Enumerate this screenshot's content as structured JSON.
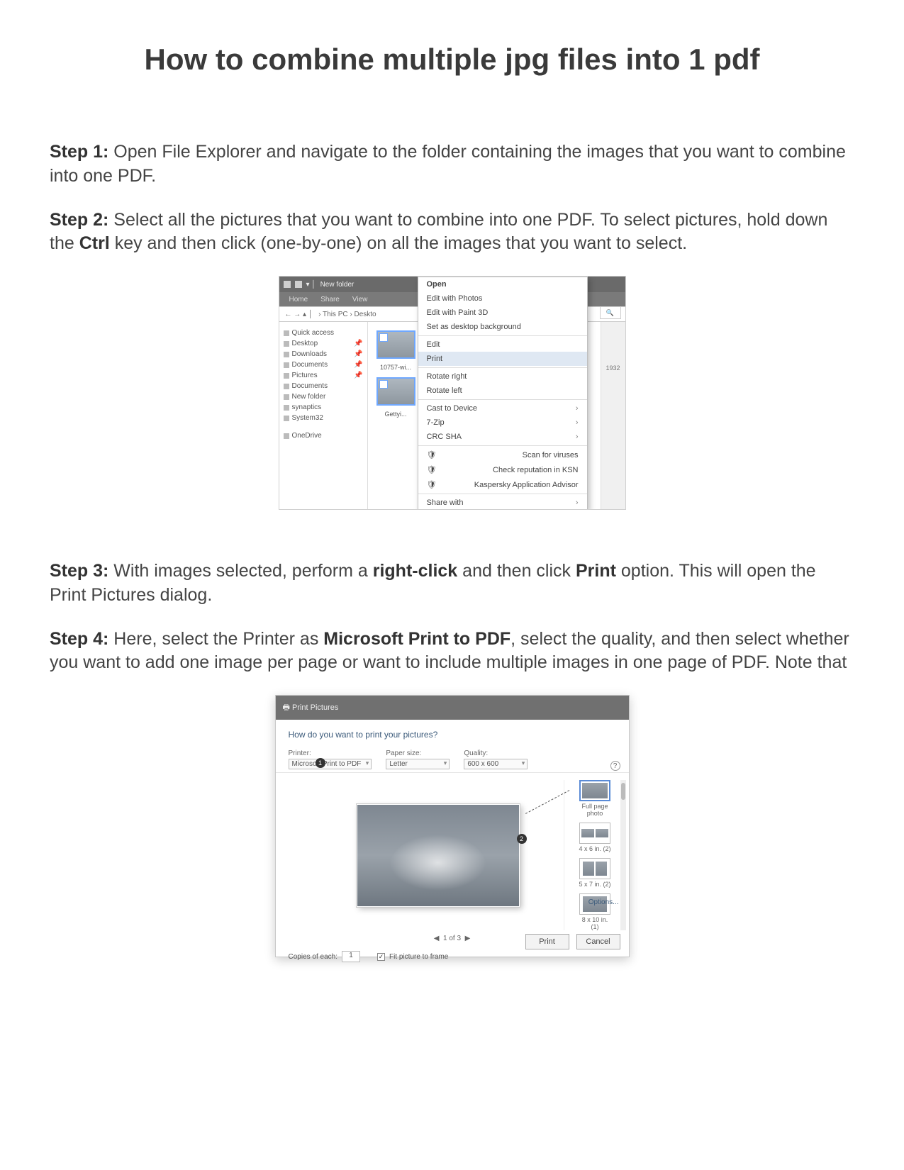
{
  "title": "How to combine multiple jpg files into 1 pdf",
  "steps": {
    "s1_label": "Step 1:",
    "s1_text": " Open File Explorer and navigate to the folder containing the images that you want to combine into one PDF.",
    "s2_label": "Step 2:",
    "s2_text_a": " Select all the pictures that you want to combine into one PDF. To select pictures, hold down the ",
    "s2_bold": "Ctrl",
    "s2_text_b": " key and then click (one-by-one) on all the images that you want to select.",
    "s3_label": "Step 3:",
    "s3_text_a": " With images selected, perform a ",
    "s3_bold1": "right-click",
    "s3_text_b": " and then click ",
    "s3_bold2": "Print",
    "s3_text_c": " option. This will open the Print Pictures dialog.",
    "s4_label": "Step 4:",
    "s4_text_a": " Here, select the Printer as ",
    "s4_bold": "Microsoft Print to PDF",
    "s4_text_b": ", select the quality, and then select whether you want to add one image per page or want to include multiple images in one page of PDF. Note that"
  },
  "explorer": {
    "window_title": "New folder",
    "ribbon": {
      "home": "Home",
      "share": "Share",
      "view": "View"
    },
    "breadcrumb": "› This PC › Deskto",
    "search_placeholder": "🔍",
    "sidebar": {
      "quick": "Quick access",
      "items": [
        "Desktop",
        "Downloads",
        "Documents",
        "Pictures",
        "Documents",
        "New folder",
        "synaptics",
        "System32"
      ],
      "onedrive": "OneDrive"
    },
    "thumbs": {
      "t1": "10757-wi...",
      "t2": "Gettyi..."
    },
    "right_value": "1932",
    "context_menu": {
      "open": "Open",
      "edit_photos": "Edit with Photos",
      "edit_paint3d": "Edit with Paint 3D",
      "set_bg": "Set as desktop background",
      "edit": "Edit",
      "print": "Print",
      "rot_r": "Rotate right",
      "rot_l": "Rotate left",
      "cast": "Cast to Device",
      "zip": "7-Zip",
      "crc": "CRC SHA",
      "scan": "Scan for viruses",
      "kasp1": "Check reputation in KSN",
      "kasp2": "Kaspersky Application Advisor",
      "share": "Share with"
    }
  },
  "print_dialog": {
    "title": "Print Pictures",
    "prompt": "How do you want to print your pictures?",
    "labels": {
      "printer": "Printer:",
      "paper": "Paper size:",
      "quality": "Quality:"
    },
    "values": {
      "printer": "Microsoft Print to PDF",
      "paper": "Letter",
      "quality": "600 x 600"
    },
    "layouts": {
      "l1": "Full page photo",
      "l2": "4 x 6 in. (2)",
      "l3": "5 x 7 in. (2)",
      "l4": "8 x 10 in. (1)"
    },
    "pager": "1 of 3",
    "copies_label": "Copies of each:",
    "copies_value": "1",
    "fit_label": "Fit picture to frame",
    "options": "Options...",
    "buttons": {
      "print": "Print",
      "cancel": "Cancel"
    },
    "callouts": {
      "c1": "1",
      "c2": "2"
    },
    "help": "?"
  }
}
